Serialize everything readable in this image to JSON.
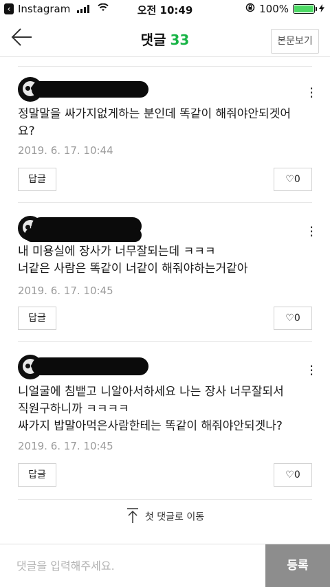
{
  "status_bar": {
    "back_app": "Instagram",
    "time": "오전 10:49",
    "battery": "100%"
  },
  "header": {
    "title": "댓글",
    "count": "33",
    "body_button": "본문보기"
  },
  "comments": [
    {
      "text_lines": [
        "정말말을 싸가지없게하는 분인데 똑같이 해줘야안되겟어",
        "요?"
      ],
      "timestamp": "2019. 6. 17. 10:44",
      "reply_label": "답글",
      "likes": "0"
    },
    {
      "text_lines": [
        "내 미용실에 장사가 너무잘되는데 ㅋㅋㅋ",
        "너같은 사람은 똑같이 너같이 해줘야하는거같아"
      ],
      "timestamp": "2019. 6. 17. 10:45",
      "reply_label": "답글",
      "likes": "0"
    },
    {
      "text_lines": [
        "니얼굴에 침뱉고 니알아서하세요 나는 장사 너무잘되서",
        "직원구하니까 ㅋㅋㅋㅋ",
        "싸가지 밥말아먹은사람한테는 똑같이 해줘야안되겟나?"
      ],
      "timestamp": "2019. 6. 17. 10:45",
      "reply_label": "답글",
      "likes": "0"
    }
  ],
  "goto_first": "첫 댓글로 이동",
  "input": {
    "placeholder": "댓글을 입력해주세요."
  },
  "submit_label": "등록",
  "colors": {
    "count": "#18b446",
    "submit_bg": "#8d8d8d"
  }
}
